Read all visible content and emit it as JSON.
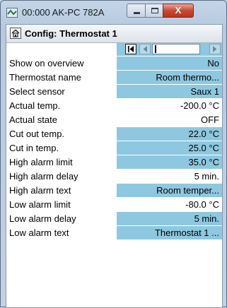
{
  "window": {
    "title": "00:000 AK-PC 782A",
    "close_glyph": "X"
  },
  "header": {
    "title": "Config: Thermostat 1"
  },
  "rows": [
    {
      "label": "Show on overview",
      "value": "No",
      "editable": true
    },
    {
      "label": "Thermostat name",
      "value": "Room thermo...",
      "editable": true
    },
    {
      "label": "Select sensor",
      "value": "Saux 1",
      "editable": true
    },
    {
      "label": "Actual temp.",
      "value": "-200.0 °C",
      "editable": false
    },
    {
      "label": "Actual state",
      "value": "OFF",
      "editable": false
    },
    {
      "label": "Cut out temp.",
      "value": "22.0 °C",
      "editable": true
    },
    {
      "label": "Cut in temp.",
      "value": "25.0 °C",
      "editable": true
    },
    {
      "label": "High alarm limit",
      "value": "35.0 °C",
      "editable": true
    },
    {
      "label": "High alarm delay",
      "value": "5 min.",
      "editable": false
    },
    {
      "label": "High alarm text",
      "value": "Room temper...",
      "editable": true
    },
    {
      "label": "Low alarm limit",
      "value": "-80.0 °C",
      "editable": false
    },
    {
      "label": "Low alarm delay",
      "value": "5 min.",
      "editable": true
    },
    {
      "label": "Low alarm text",
      "value": "Thermostat 1 ...",
      "editable": true
    }
  ],
  "colors": {
    "editable_cell": "#8ec8e0",
    "window_frame": "#b6c9de",
    "close_button": "#c74a35"
  },
  "icons": {
    "app": "app-icon",
    "home": "home-icon",
    "first": "nav-first-icon",
    "prev": "nav-prev-icon",
    "next": "nav-next-icon"
  }
}
